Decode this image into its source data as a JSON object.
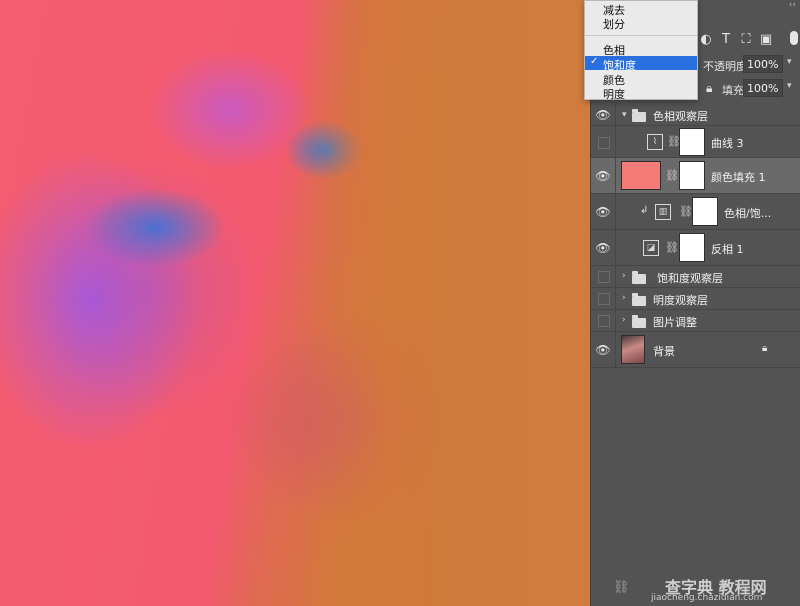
{
  "blend_menu": {
    "items_group1": [
      "减去",
      "划分"
    ],
    "items_group2": [
      {
        "label": "色相",
        "selected": false
      },
      {
        "label": "饱和度",
        "selected": true
      },
      {
        "label": "颜色",
        "selected": false
      },
      {
        "label": "明度",
        "selected": false
      }
    ],
    "check_mark": "✓"
  },
  "layers_panel": {
    "collapse_glyph": "‹‹",
    "toolbar_icons": [
      "adjustment-circle-icon",
      "type-tool-icon",
      "transform-icon",
      "smart-object-icon"
    ],
    "opacity_label": "不透明度:",
    "opacity_value": "100%",
    "fill_label": "填充:",
    "fill_value": "100%",
    "layers": [
      {
        "name": "色相观察层",
        "kind": "group",
        "visible": true,
        "expanded": true
      },
      {
        "name": "曲线 3",
        "kind": "curves",
        "visible": false
      },
      {
        "name": "颜色填充 1",
        "kind": "fill",
        "visible": true,
        "selected": true,
        "fill_color": "#f47b78"
      },
      {
        "name": "色相/饱...",
        "kind": "hue-saturation",
        "visible": true,
        "clipped": true
      },
      {
        "name": "反相 1",
        "kind": "invert",
        "visible": true
      },
      {
        "name": "饱和度观察层",
        "kind": "group",
        "visible": false,
        "expanded": false
      },
      {
        "name": "明度观察层",
        "kind": "group",
        "visible": false,
        "expanded": false
      },
      {
        "name": "图片调整",
        "kind": "group",
        "visible": false,
        "expanded": false
      },
      {
        "name": "背景",
        "kind": "background",
        "visible": true,
        "locked": true
      }
    ]
  },
  "watermark": {
    "brand": "查字典 教程网",
    "url": "jiaocheng.chazidian.com"
  },
  "colors": {
    "menu_highlight": "#2a6fe0",
    "panel_bg": "#535353",
    "selected_layer": "#6a6a6a",
    "fill_swatch": "#f47b78"
  }
}
